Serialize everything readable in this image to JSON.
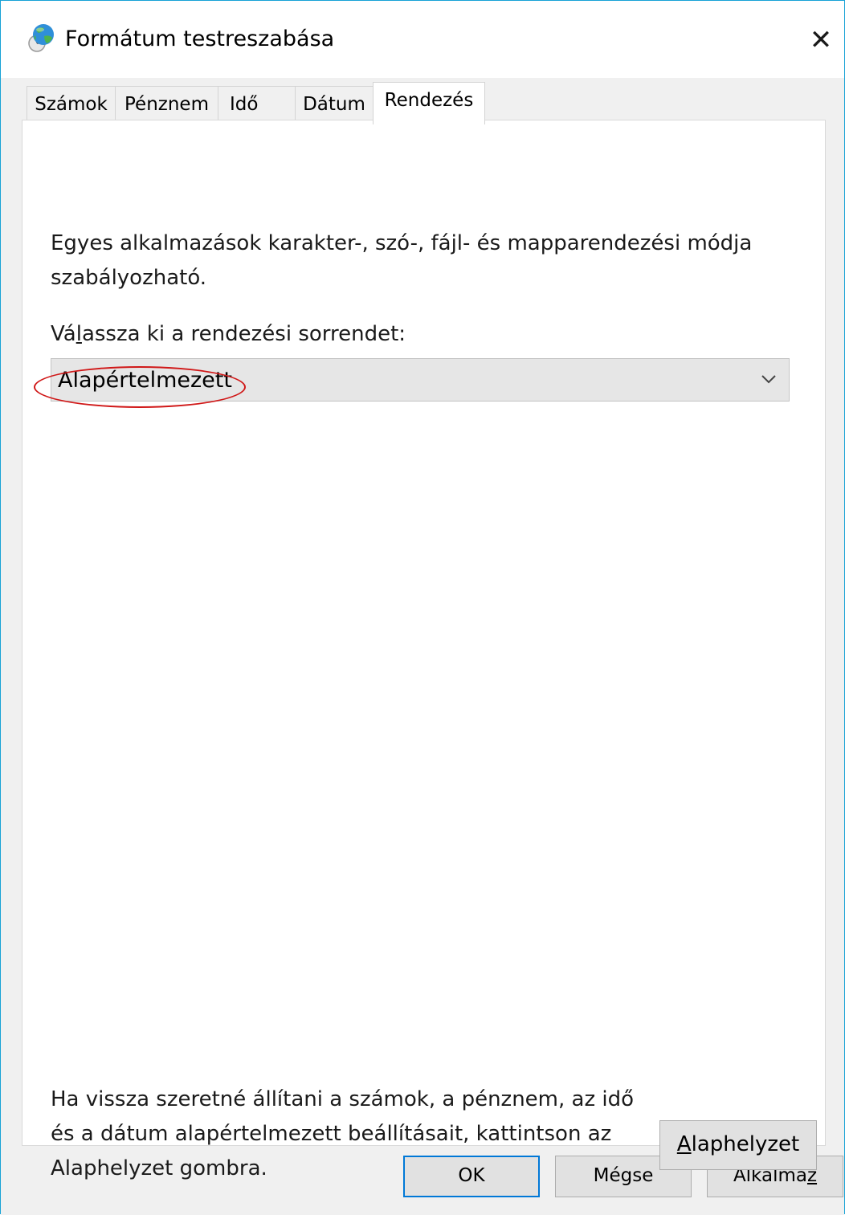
{
  "window": {
    "title": "Formátum testreszabása",
    "close_symbol": "✕",
    "accent": "#17a2d6"
  },
  "tabs": [
    {
      "label": "Számok"
    },
    {
      "label": "Pénznem"
    },
    {
      "label": "Idő"
    },
    {
      "label": "Dátum"
    },
    {
      "label": "Rendezés",
      "active": true
    }
  ],
  "panel": {
    "description": "Egyes alkalmazások karakter-, szó-, fájl- és mapparendezési módja szabályozható.",
    "select_label_pre": "Vá",
    "select_label_mnemonic": "l",
    "select_label_post": "assza ki a rendezési sorrendet:",
    "select_value": "Alapértelmezett",
    "highlight_color": "#d01818",
    "reset_description": "Ha vissza szeretné állítani a számok, a pénznem, az idő és a dátum alapértelmezett beállításait, kattintson az Alaphelyzet gombra.",
    "reset_button_mnemonic": "A",
    "reset_button_rest": "laphelyzet"
  },
  "buttons": {
    "ok": "OK",
    "cancel": "Mégse",
    "apply_pre": "Alkalma",
    "apply_mnemonic": "z",
    "default_border": "#0078d7"
  }
}
